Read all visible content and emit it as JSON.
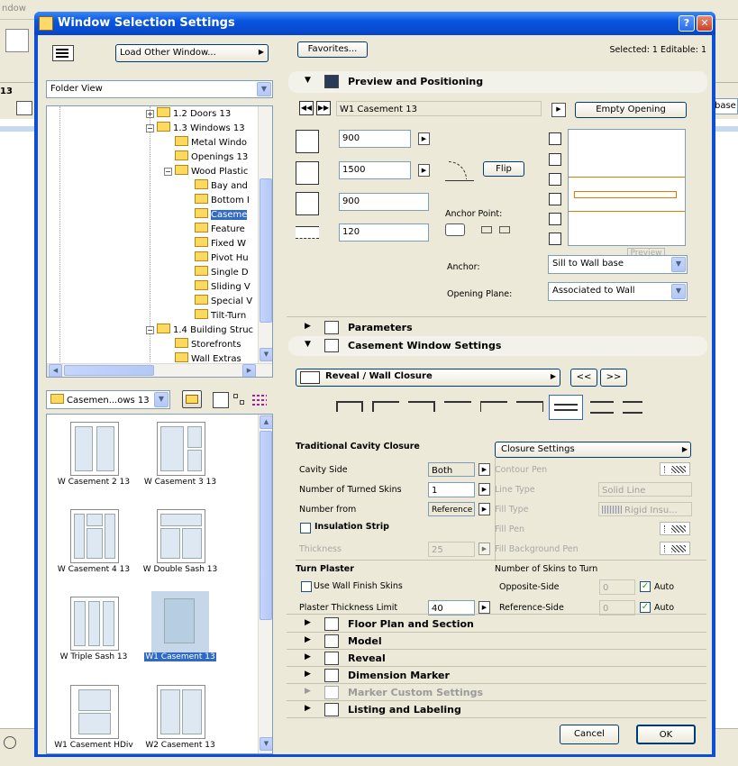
{
  "background_app": {
    "menu_fragment": "ndow",
    "label_13": "13",
    "base_fragment": "base"
  },
  "dialog": {
    "title": "Window Selection Settings",
    "help_label": "?",
    "close_label": "✕"
  },
  "left": {
    "load_other_window": "Load Other Window...",
    "view_mode": "Folder View",
    "tree": [
      {
        "label": "1.2 Doors 13"
      },
      {
        "label": "1.3 Windows 13"
      },
      {
        "label": "Metal Windo"
      },
      {
        "label": "Openings 13"
      },
      {
        "label": "Wood Plastic"
      },
      {
        "label": "Bay and"
      },
      {
        "label": "Bottom I"
      },
      {
        "label": "Caseme"
      },
      {
        "label": "Feature"
      },
      {
        "label": "Fixed W"
      },
      {
        "label": "Pivot Hu"
      },
      {
        "label": "Single D"
      },
      {
        "label": "Sliding V"
      },
      {
        "label": "Special V"
      },
      {
        "label": "Tilt-Turn"
      },
      {
        "label": "1.4 Building Struc"
      },
      {
        "label": "Storefronts"
      },
      {
        "label": "Wall Extras"
      }
    ],
    "folder_combo": "Casemen...ows 13",
    "library_items": [
      {
        "label": "W Casement 2 13"
      },
      {
        "label": "W Casement 3 13"
      },
      {
        "label": "W Casement 4 13"
      },
      {
        "label": "W Double Sash 13"
      },
      {
        "label": "W Triple Sash 13"
      },
      {
        "label": "W1 Casement 13"
      },
      {
        "label": "W1 Casement HDiv"
      },
      {
        "label": "W2 Casement 13"
      }
    ]
  },
  "right": {
    "favorites": "Favorites...",
    "selected_info": "Selected: 1 Editable: 1",
    "preview_section": "Preview and Positioning",
    "object_name": "W1 Casement 13",
    "empty_opening": "Empty Opening",
    "dims": [
      "900",
      "1500",
      "900",
      "120"
    ],
    "flip": "Flip",
    "anchor_point_label": "Anchor Point:",
    "anchor_label": "Anchor:",
    "anchor_value": "Sill to Wall base",
    "opening_plane_label": "Opening Plane:",
    "opening_plane_value": "Associated to Wall",
    "preview_tab": "Preview",
    "parameters_section": "Parameters",
    "casement_section": "Casement Window Settings",
    "reveal_combo": "Reveal / Wall Closure",
    "prev_btn": "<<",
    "next_btn": ">>",
    "traditional_cavity": "Traditional Cavity Closure",
    "closure_settings": "Closure Settings",
    "cavity_side_label": "Cavity Side",
    "cavity_side_value": "Both",
    "turned_skins_label": "Number of Turned Skins",
    "turned_skins_value": "1",
    "number_from_label": "Number from",
    "number_from_value": "Reference",
    "insulation_strip": "Insulation Strip",
    "thickness_label": "Thickness",
    "thickness_value": "25",
    "contour_pen": "Contour Pen",
    "line_type_label": "Line Type",
    "line_type_value": "Solid Line",
    "fill_type_label": "Fill Type",
    "fill_type_value": "Rigid Insu...",
    "fill_pen": "Fill Pen",
    "fill_bg_pen": "Fill Background Pen",
    "turn_plaster": "Turn Plaster",
    "use_wall_finish": "Use Wall Finish Skins",
    "plaster_limit_label": "Plaster Thickness Limit",
    "plaster_limit_value": "40",
    "skins_to_turn": "Number of Skins to Turn",
    "opposite_side": "Opposite-Side",
    "opposite_value": "0",
    "reference_side": "Reference-Side",
    "reference_value": "0",
    "auto": "Auto",
    "sections": [
      {
        "label": "Floor Plan and Section"
      },
      {
        "label": "Model"
      },
      {
        "label": "Reveal"
      },
      {
        "label": "Dimension Marker"
      },
      {
        "label": "Marker Custom Settings"
      },
      {
        "label": "Listing and Labeling"
      }
    ],
    "cancel": "Cancel",
    "ok": "OK"
  }
}
